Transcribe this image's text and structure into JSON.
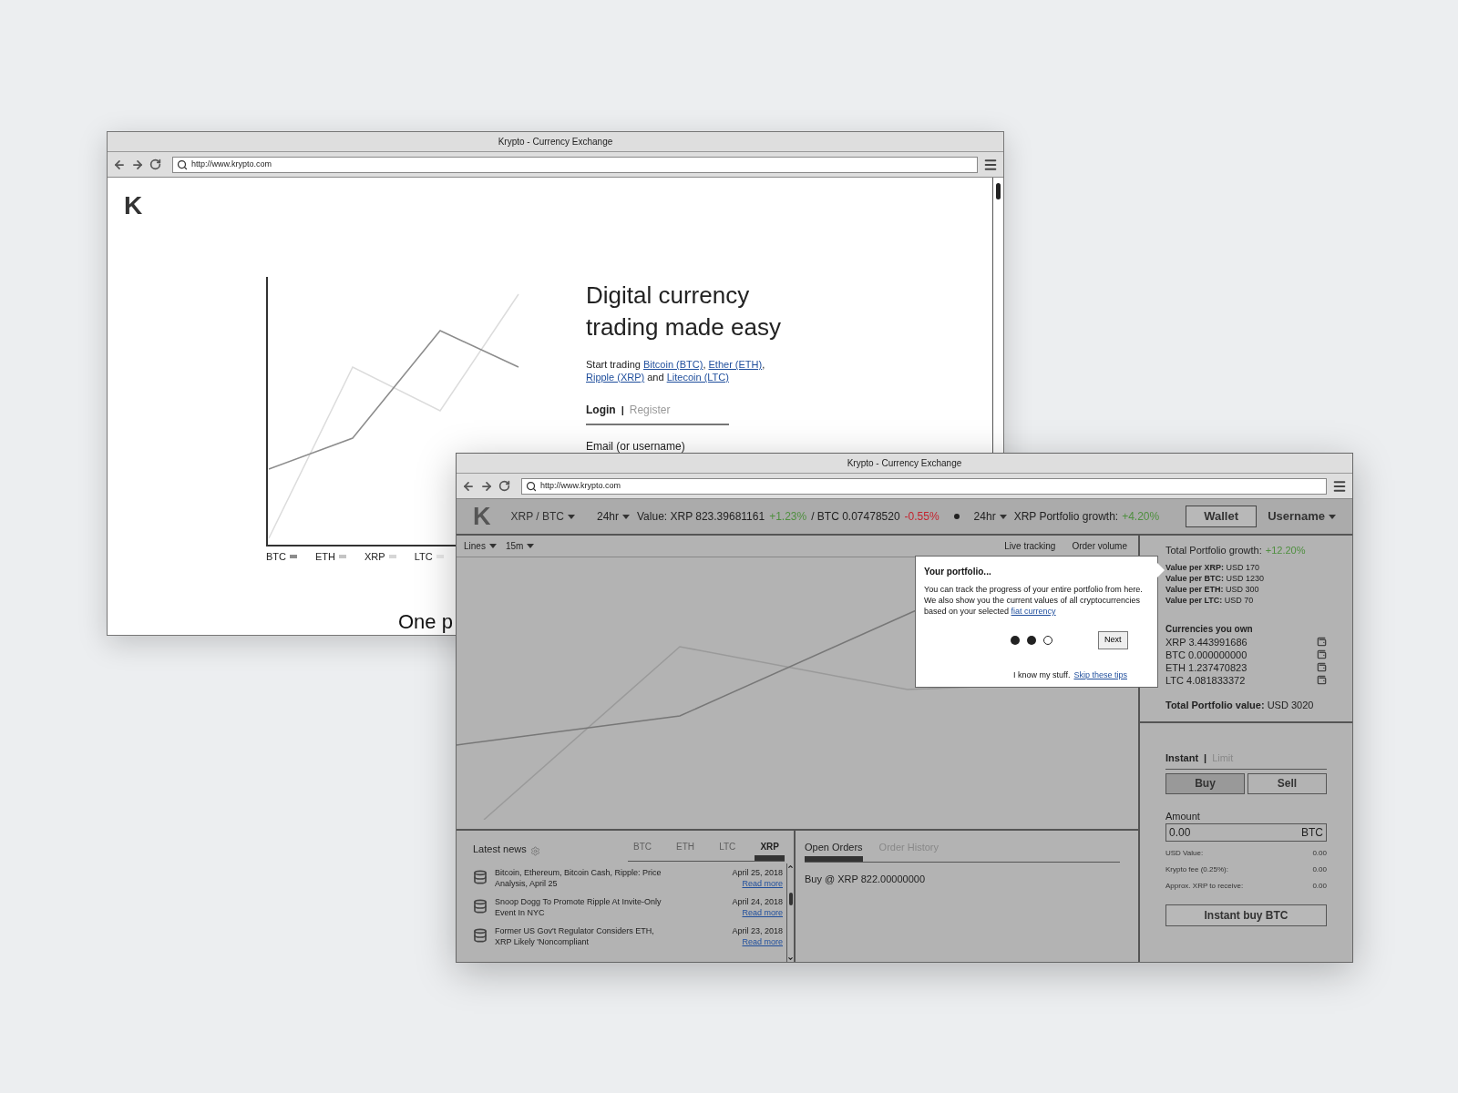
{
  "back_window": {
    "title": "Krypto - Currency Exchange",
    "url": "http://www.krypto.com",
    "logo": "K",
    "legend": [
      {
        "label": "BTC",
        "color": "#8c8c8c"
      },
      {
        "label": "ETH",
        "color": "#c4c4c4"
      },
      {
        "label": "XRP",
        "color": "#d6d6d6"
      },
      {
        "label": "LTC",
        "color": "#e8e8e8"
      }
    ],
    "heading": "Digital currency trading made easy",
    "intro": [
      {
        "kind": "text",
        "text": "Start trading "
      },
      {
        "kind": "link",
        "text": "Bitcoin (BTC)"
      },
      {
        "kind": "text",
        "text": ", "
      },
      {
        "kind": "link",
        "text": "Ether (ETH)"
      },
      {
        "kind": "text",
        "text": ", "
      },
      {
        "kind": "link",
        "text": "Ripple (XRP)"
      },
      {
        "kind": "text",
        "text": " and "
      },
      {
        "kind": "link",
        "text": "Litecoin (LTC)"
      }
    ],
    "auth_tabs": [
      {
        "label": "Login",
        "selected": true
      },
      {
        "label": "Register",
        "selected": false
      }
    ],
    "tab_separator": "|",
    "email_label": "Email (or username)",
    "footer_heading": "One p"
  },
  "front_window": {
    "title": "Krypto - Currency Exchange",
    "url": "http://www.krypto.com",
    "logo": "K",
    "pair": "XRP / BTC",
    "period": "24hr",
    "ticker": [
      {
        "kind": "plain",
        "text": "Value: XRP 823.39681161"
      },
      {
        "kind": "up",
        "text": "+1.23%"
      },
      {
        "kind": "plain",
        "text": "/ BTC 0.07478520"
      },
      {
        "kind": "down",
        "text": "-0.55%"
      }
    ],
    "growth_period": "24hr",
    "growth_label": "XRP Portfolio growth:",
    "growth_value": "+4.20%",
    "wallet_button": "Wallet",
    "user_menu": "Username",
    "chart_dropdowns": [
      "Lines",
      "15m"
    ],
    "chart_options": [
      "Live tracking",
      "Order volume"
    ],
    "tooltip": {
      "title": "Your portfolio...",
      "body": [
        {
          "kind": "text",
          "text": "You can track the progress of your entire portfolio from here. We also show you the current values of all cryptocurrencies based on your selected "
        },
        {
          "kind": "link",
          "text": "fiat currency"
        }
      ],
      "steps": [
        {
          "done": true
        },
        {
          "done": true
        },
        {
          "done": false
        }
      ],
      "next_button": "Next",
      "footer_text": "I know my stuff.",
      "skip_link": "Skip these tips"
    },
    "portfolio": {
      "growth_label": "Total Portfolio growth:",
      "growth_value": "+12.20%",
      "values": [
        "**Value per XRP:** USD 170",
        "**Value per BTC:** USD 1230",
        "**Value per ETH:** USD 300",
        "**Value per LTC:** USD 70"
      ],
      "holdings_title": "Currencies you own",
      "holdings": [
        "XRP 3.443991686",
        "BTC 0.000000000",
        "ETH 1.237470823",
        "LTC 4.081833372"
      ],
      "total": "**Total Portfolio value:** USD 3020"
    },
    "trade": {
      "modes": [
        {
          "label": "Instant",
          "selected": true
        },
        {
          "label": "Limit",
          "selected": false
        }
      ],
      "mode_separator": "|",
      "sides": [
        {
          "label": "Buy",
          "selected": true
        },
        {
          "label": "Sell",
          "selected": false
        }
      ],
      "amount_label": "Amount",
      "amount_value": "0.00",
      "amount_unit": "BTC",
      "rows": [
        {
          "label": "USD Value:",
          "value": "0.00"
        },
        {
          "label": "Krypto fee (0.25%):",
          "value": "0.00"
        },
        {
          "label": "Approx. XRP to receive:",
          "value": "0.00"
        }
      ],
      "submit_button": "Instant buy BTC"
    },
    "news": {
      "title": "Latest news",
      "tabs": [
        {
          "label": "BTC",
          "selected": false
        },
        {
          "label": "ETH",
          "selected": false
        },
        {
          "label": "LTC",
          "selected": false
        },
        {
          "label": "XRP",
          "selected": true
        }
      ],
      "items": [
        {
          "title": "Bitcoin, Ethereum, Bitcoin Cash, Ripple: Price Analysis, April 25",
          "date": "April 25, 2018",
          "link": "Read more"
        },
        {
          "title": "Snoop Dogg To Promote Ripple At Invite-Only Event In NYC",
          "date": "April 24, 2018",
          "link": "Read more"
        },
        {
          "title": "Former US Gov't Regulator Considers ETH, XRP Likely 'Noncompliant",
          "date": "April 23, 2018",
          "link": "Read more"
        }
      ]
    },
    "orders": {
      "tabs": [
        {
          "label": "Open Orders",
          "selected": true
        },
        {
          "label": "Order History",
          "selected": false
        }
      ],
      "rows": [
        "Buy @ XRP 822.00000000"
      ]
    }
  }
}
